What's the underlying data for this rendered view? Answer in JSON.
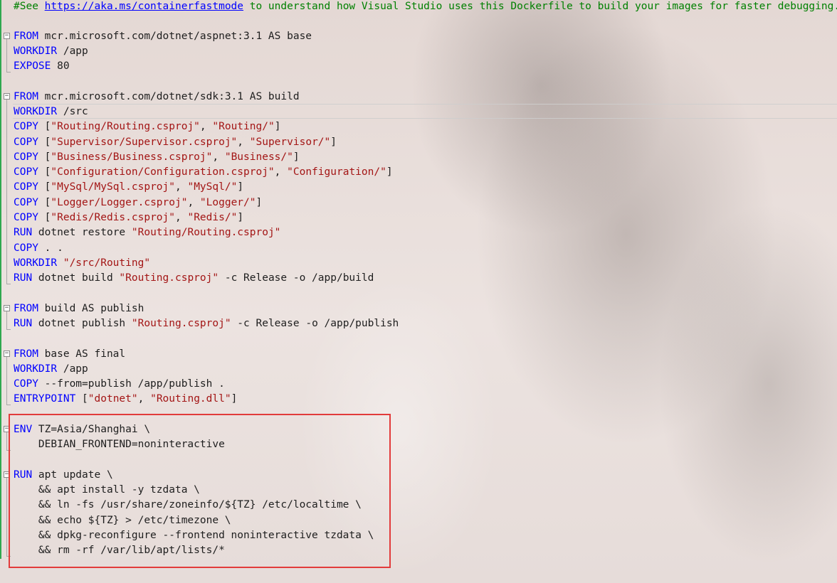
{
  "editor": {
    "comment_prefix": "#See ",
    "comment_link": "https://aka.ms/containerfastmode",
    "comment_suffix": " to understand how Visual Studio uses this Dockerfile to build your images for faster debugging.",
    "fold_symbol": "−",
    "lines": {
      "l2": {
        "kw": "FROM",
        "rest": " mcr.microsoft.com/dotnet/aspnet:3.1 AS base"
      },
      "l3": {
        "kw": "WORKDIR",
        "rest": " /app"
      },
      "l4": {
        "kw": "EXPOSE",
        "rest": " 80"
      },
      "l6": {
        "kw": "FROM",
        "rest": " mcr.microsoft.com/dotnet/sdk:3.1 AS build"
      },
      "l7": {
        "kw": "WORKDIR",
        "rest": " /src"
      },
      "l8": {
        "kw": "COPY",
        "p1": " [",
        "s1": "\"Routing/Routing.csproj\"",
        "p2": ", ",
        "s2": "\"Routing/\"",
        "p3": "]"
      },
      "l9": {
        "kw": "COPY",
        "p1": " [",
        "s1": "\"Supervisor/Supervisor.csproj\"",
        "p2": ", ",
        "s2": "\"Supervisor/\"",
        "p3": "]"
      },
      "l10": {
        "kw": "COPY",
        "p1": " [",
        "s1": "\"Business/Business.csproj\"",
        "p2": ", ",
        "s2": "\"Business/\"",
        "p3": "]"
      },
      "l11": {
        "kw": "COPY",
        "p1": " [",
        "s1": "\"Configuration/Configuration.csproj\"",
        "p2": ", ",
        "s2": "\"Configuration/\"",
        "p3": "]"
      },
      "l12": {
        "kw": "COPY",
        "p1": " [",
        "s1": "\"MySql/MySql.csproj\"",
        "p2": ", ",
        "s2": "\"MySql/\"",
        "p3": "]"
      },
      "l13": {
        "kw": "COPY",
        "p1": " [",
        "s1": "\"Logger/Logger.csproj\"",
        "p2": ", ",
        "s2": "\"Logger/\"",
        "p3": "]"
      },
      "l14": {
        "kw": "COPY",
        "p1": " [",
        "s1": "\"Redis/Redis.csproj\"",
        "p2": ", ",
        "s2": "\"Redis/\"",
        "p3": "]"
      },
      "l15": {
        "kw": "RUN",
        "p1": " dotnet restore ",
        "s1": "\"Routing/Routing.csproj\""
      },
      "l16": {
        "kw": "COPY",
        "rest": " . ."
      },
      "l17": {
        "kw": "WORKDIR",
        "p1": " ",
        "s1": "\"/src/Routing\""
      },
      "l18": {
        "kw": "RUN",
        "p1": " dotnet build ",
        "s1": "\"Routing.csproj\"",
        "p2": " -c Release -o /app/build"
      },
      "l20": {
        "kw": "FROM",
        "rest": " build AS publish"
      },
      "l21": {
        "kw": "RUN",
        "p1": " dotnet publish ",
        "s1": "\"Routing.csproj\"",
        "p2": " -c Release -o /app/publish"
      },
      "l23": {
        "kw": "FROM",
        "rest": " base AS final"
      },
      "l24": {
        "kw": "WORKDIR",
        "rest": " /app"
      },
      "l25": {
        "kw": "COPY",
        "rest": " --from=publish /app/publish ."
      },
      "l26": {
        "kw": "ENTRYPOINT",
        "p1": " [",
        "s1": "\"dotnet\"",
        "p2": ", ",
        "s2": "\"Routing.dll\"",
        "p3": "]"
      },
      "l28": {
        "kw": "ENV",
        "rest": " TZ=Asia/Shanghai \\"
      },
      "l29": {
        "text": "    DEBIAN_FRONTEND=noninteractive"
      },
      "l31": {
        "kw": "RUN",
        "rest": " apt update \\"
      },
      "l32": {
        "text": "    && apt install -y tzdata \\"
      },
      "l33": {
        "text": "    && ln -fs /usr/share/zoneinfo/${TZ} /etc/localtime \\"
      },
      "l34": {
        "text": "    && echo ${TZ} > /etc/timezone \\"
      },
      "l35": {
        "text": "    && dpkg-reconfigure --frontend noninteractive tzdata \\"
      },
      "l36": {
        "text": "    && rm -rf /var/lib/apt/lists/*"
      }
    }
  },
  "colors": {
    "keyword": "#0000ff",
    "string": "#a31515",
    "comment": "#008000",
    "highlight_box": "#e23b3b",
    "change_bar": "#2fa84f"
  }
}
